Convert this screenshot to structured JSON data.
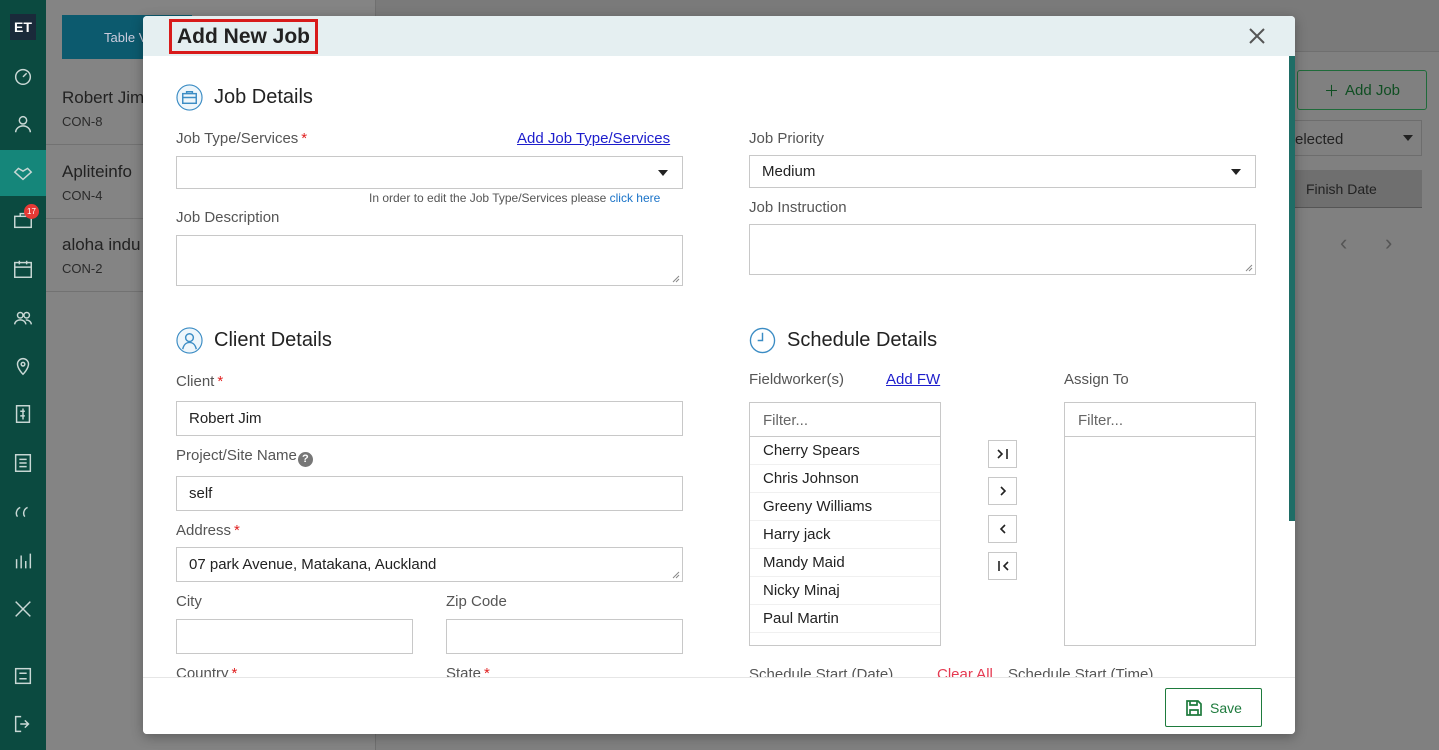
{
  "app": {
    "logo": "ET",
    "notification_count": "17"
  },
  "background": {
    "table_view_label": "Table V",
    "jobs_list": [
      {
        "name": "Robert Jim",
        "code": "CON-8"
      },
      {
        "name": "Apliteinfo",
        "code": "CON-4"
      },
      {
        "name": "aloha indu",
        "code": "CON-2"
      }
    ],
    "add_job_label": "Add Job",
    "filter_select_value": "elected",
    "finish_date_header": "Finish Date",
    "prev_glyph": "‹",
    "next_glyph": "›"
  },
  "modal": {
    "title": "Add New Job",
    "job_details": {
      "title": "Job Details",
      "job_type_label": "Job Type/Services",
      "required_mark": "*",
      "add_job_type_link": "Add Job Type/Services",
      "job_type_value": "",
      "hint_prefix": "In order to edit the Job Type/Services please",
      "hint_link": "click here",
      "job_description_label": "Job Description",
      "job_description_value": "",
      "job_priority_label": "Job Priority",
      "job_priority_value": "Medium",
      "job_instruction_label": "Job Instruction",
      "job_instruction_value": ""
    },
    "client_details": {
      "title": "Client Details",
      "client_label": "Client",
      "client_value": "Robert Jim",
      "project_label": "Project/Site Name",
      "help_glyph": "?",
      "project_value": "self",
      "address_label": "Address",
      "address_value": "07 park Avenue, Matakana, Auckland",
      "city_label": "City",
      "city_value": "",
      "zip_label": "Zip Code",
      "zip_value": "",
      "country_label": "Country",
      "state_label": "State"
    },
    "schedule_details": {
      "title": "Schedule Details",
      "fieldworkers_label": "Fieldworker(s)",
      "add_fw_link": "Add FW",
      "assign_to_label": "Assign To",
      "filter_placeholder": "Filter...",
      "fieldworkers": [
        "Cherry Spears",
        "Chris Johnson",
        "Greeny Williams",
        "Harry jack",
        "Mandy Maid",
        "Nicky Minaj",
        "Paul Martin"
      ],
      "assigned": [],
      "schedule_start_date_label": "Schedule Start (Date)",
      "clear_all_label": "Clear All",
      "schedule_start_time_label": "Schedule Start (Time)"
    },
    "save_label": "Save"
  },
  "colors": {
    "sidebar": "#0b4a40",
    "accent_green": "#1e7b3d",
    "required_red": "#e02020",
    "link_blue": "#1d1dcc",
    "title_highlight": "#d81b1b"
  }
}
